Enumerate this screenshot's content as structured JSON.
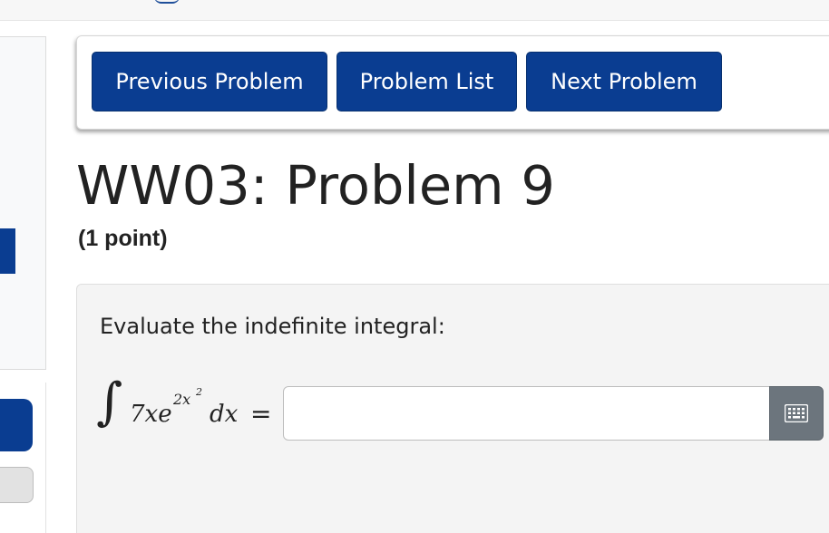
{
  "nav": {
    "previous_label": "Previous Problem",
    "list_label": "Problem List",
    "next_label": "Next Problem"
  },
  "problem": {
    "title": "WW03: Problem 9",
    "points": "(1 point)",
    "prompt": "Evaluate the indefinite integral:",
    "integral": {
      "integral_sign": "∫",
      "integrand": "7xe",
      "exponent": "2x",
      "exponent_power": "2",
      "differential": "dx",
      "equals": "="
    },
    "answer": {
      "value": "",
      "placeholder": ""
    }
  },
  "icons": {
    "keypad": "keypad-icon"
  },
  "colors": {
    "primary": "#0a3d91",
    "keypad_button": "#6c757d",
    "card_background": "#f4f4f4"
  }
}
